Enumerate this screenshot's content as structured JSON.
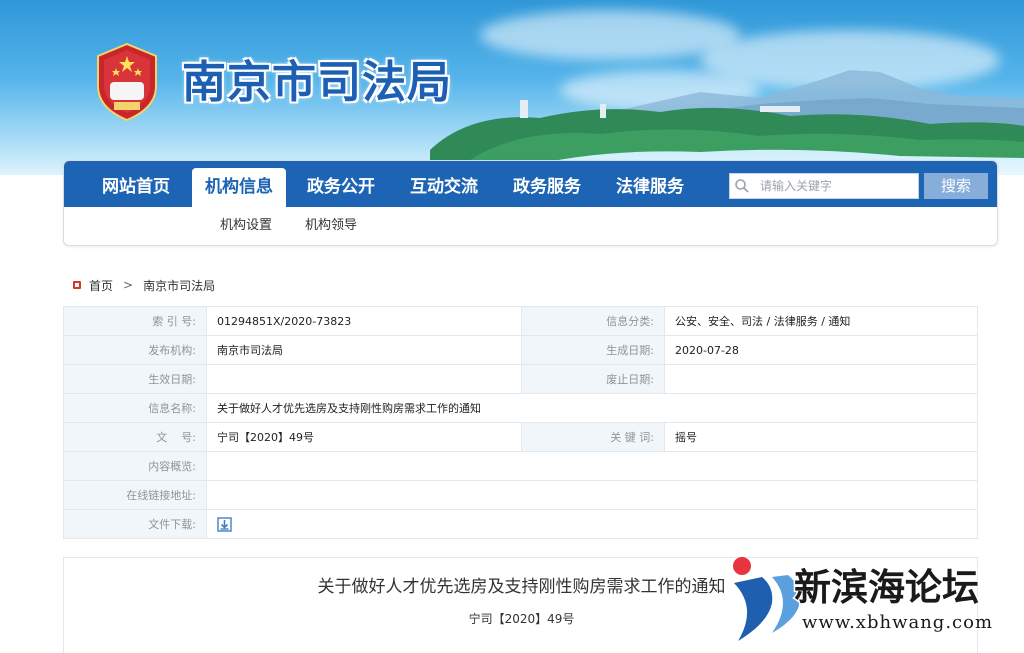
{
  "site": {
    "title": "南京市司法局"
  },
  "nav": {
    "items": [
      "网站首页",
      "机构信息",
      "政务公开",
      "互动交流",
      "政务服务",
      "法律服务"
    ],
    "active_index": 1,
    "search_placeholder": "请输入关键字",
    "search_button": "搜索",
    "subitems": [
      "机构设置",
      "机构领导"
    ]
  },
  "breadcrumb": {
    "home": "首页",
    "separator": ">",
    "current": "南京市司法局"
  },
  "info": {
    "index_label": "索 引 号:",
    "index_value": "01294851X/2020-73823",
    "category_label": "信息分类:",
    "category_value": "公安、安全、司法 / 法律服务 / 通知",
    "publisher_label": "发布机构:",
    "publisher_value": "南京市司法局",
    "created_label": "生成日期:",
    "created_value": "2020-07-28",
    "effective_label": "生效日期:",
    "effective_value": "",
    "expired_label": "废止日期:",
    "expired_value": "",
    "name_label": "信息名称:",
    "name_value": "关于做好人才优先选房及支持刚性购房需求工作的通知",
    "docno_label": "文    号:",
    "docno_value": "宁司【2020】49号",
    "keyword_label": "关 键 词:",
    "keyword_value": "摇号",
    "summary_label": "内容概览:",
    "summary_value": "",
    "link_label": "在线链接地址:",
    "link_value": "",
    "download_label": "文件下载:"
  },
  "article": {
    "title": "关于做好人才优先选房及支持刚性购房需求工作的通知",
    "doc_number": "宁司【2020】49号"
  },
  "watermark": {
    "name": "新滨海论坛",
    "url": "www.xbhwang.com"
  },
  "colors": {
    "nav_blue": "#1d64b4",
    "label_bg": "#f1f6fb",
    "search_btn": "#87aedb",
    "watermark_blue": "#1f5fb0",
    "watermark_red": "#e8343f"
  }
}
